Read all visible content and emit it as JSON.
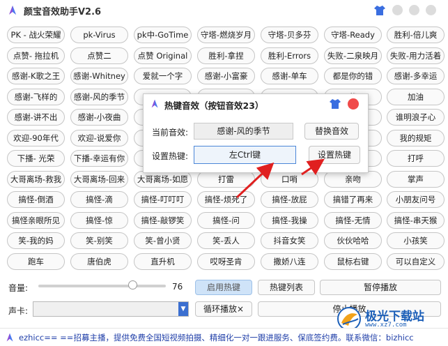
{
  "app": {
    "title": "颜宝音效助手V2.6"
  },
  "grid": [
    [
      "PK - 战火荣耀",
      "pk-Virus",
      "pk中-GoTime",
      "守塔-燃烧岁月",
      "守塔-贝多芬",
      "守塔-Ready",
      "胜利-倍儿爽"
    ],
    [
      "点赞- 拖拉机",
      "点赞二",
      "点赞 Original",
      "胜利-拿捏",
      "胜利-Errors",
      "失败-二泉映月",
      "失败-用力活着"
    ],
    [
      "感谢-K歌之王",
      "感谢-Whitney",
      "爱就一个字",
      "感谢-小富豪",
      "感谢-单车",
      "都是你的错",
      "感谢-多幸运"
    ],
    [
      "感谢-飞样的",
      "感谢-风的季节",
      "",
      "",
      "",
      "伴",
      "加油"
    ],
    [
      "感谢-讲不出",
      "感谢-小夜曲",
      "",
      "",
      "",
      "",
      "谁明浪子心"
    ],
    [
      "欢迎-90年代",
      "欢迎-说爱你",
      "D",
      "",
      "",
      "",
      "我的规矩"
    ],
    [
      "下播- 光荣",
      "下播-幸运有你",
      "",
      "",
      "",
      "",
      "打呼"
    ],
    [
      "大哥离场-救我",
      "大哥离场-回来",
      "大哥离场-如愿",
      "打雷",
      "口哨",
      "亲吻",
      "掌声"
    ],
    [
      "搞怪-倒酒",
      "搞怪-滴",
      "搞怪-叮叮叮",
      "搞怪-烦死了",
      "搞怪-放屁",
      "搞错了再来",
      "小朋友问号"
    ],
    [
      "搞怪亲眼所见",
      "搞怪-惊",
      "搞怪-敲锣笑",
      "搞怪-问",
      "搞怪-我操",
      "搞怪-无情",
      "搞怪-串天猴"
    ],
    [
      "笑-我的妈",
      "笑-别笑",
      "笑-曾小贤",
      "笑-丢人",
      "抖音女笑",
      "伙伙哈哈",
      "小孩笑"
    ],
    [
      "跑车",
      "唐伯虎",
      "直升机",
      "哎呀圣肯",
      "撒娇八连",
      "鼠标右键",
      "可以自定义"
    ]
  ],
  "dialog": {
    "title": "热键音效（按钮音效23）",
    "current_label": "当前音效:",
    "current_value": "感谢-风的季节",
    "replace_button": "替换音效",
    "hotkey_label": "设置热键:",
    "hotkey_value": "左Ctrl键",
    "set_hotkey_button": "设置热键"
  },
  "controls": {
    "volume_label": "音量:",
    "volume_value": "76",
    "volume_level": 0.76,
    "enable_hotkey": "启用热键",
    "hotkey_list": "热键列表",
    "pause_button": "暂停播放",
    "soundcard_label": "声卡:",
    "soundcard_value": "",
    "loop_button": "循环播放×",
    "stop_button": "停止播放"
  },
  "footer": {
    "text": "ezhicc== ==招募主播，提供免费全国短视频拍摄、精细化一对一跟进服务、保底签约费。联系微信：bizhicc"
  },
  "watermark": {
    "title": "极光下载站",
    "url": "www.xz7.com"
  },
  "colors": {
    "accent": "#3b6fd0",
    "close": "#f04a4a",
    "arrow": "#e02020",
    "footer_text": "#1f3ea8"
  }
}
